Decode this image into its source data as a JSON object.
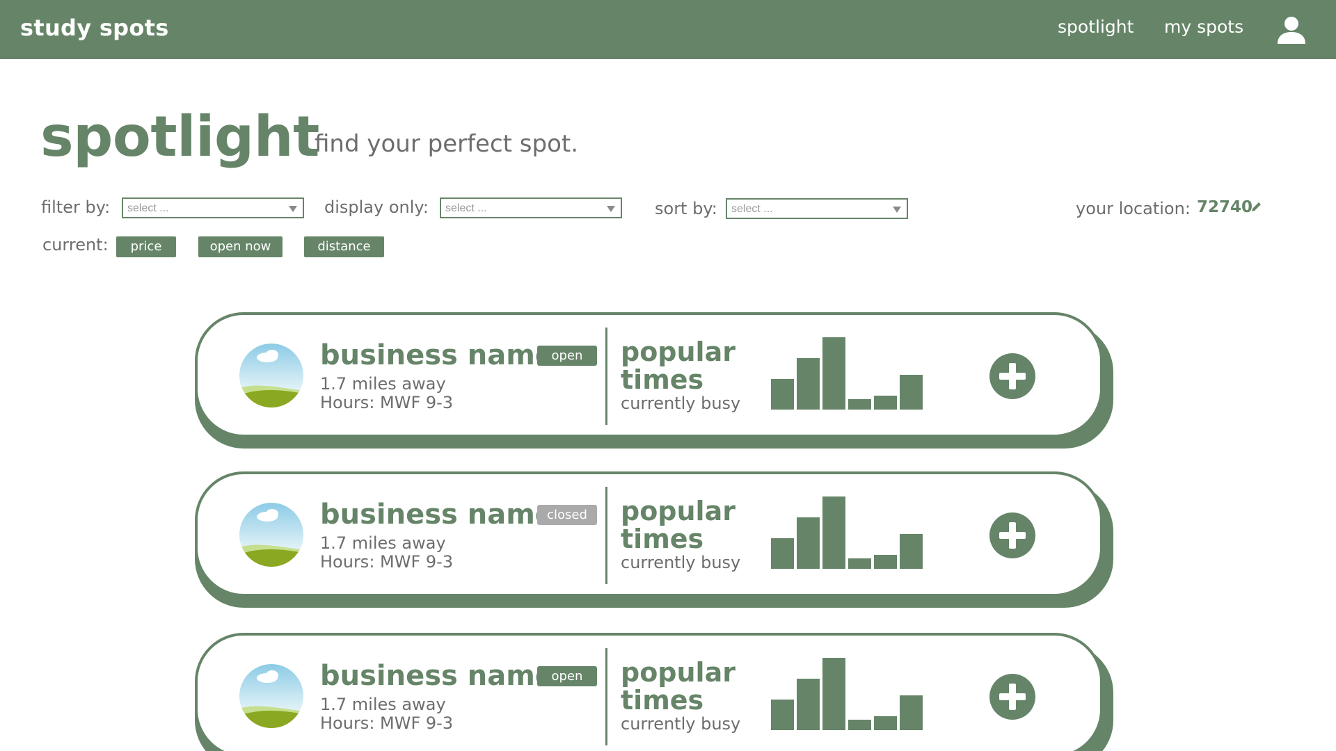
{
  "app": {
    "brand": "study spots",
    "nav": [
      {
        "label": "spotlight"
      },
      {
        "label": "my spots"
      }
    ],
    "user_icon": "user-icon"
  },
  "header": {
    "title": "spotlight",
    "subtitle": "find your perfect spot."
  },
  "controls": {
    "filter_label": "filter by:",
    "filter_placeholder": "select ...",
    "display_label": "display only:",
    "display_placeholder": "select ...",
    "sort_label": "sort by:",
    "sort_placeholder": "select ...",
    "location_label": "your location:",
    "location_value": "72740",
    "edit_icon": "pencil-icon"
  },
  "current": {
    "label": "current:",
    "chips": [
      "price",
      "open now",
      "distance"
    ]
  },
  "colors": {
    "accent": "#668568",
    "closed": "#aaaaaa",
    "text": "#6d6d6d"
  },
  "listings": [
    {
      "name": "business name",
      "status": "open",
      "distance": "1.7 miles away",
      "hours": "Hours: MWF 9-3",
      "popular_title_1": "popular",
      "popular_title_2": "times",
      "busyness": "currently busy",
      "popular_times": [
        0.42,
        0.71,
        1.0,
        0.14,
        0.19,
        0.48
      ]
    },
    {
      "name": "business name",
      "status": "closed",
      "distance": "1.7 miles away",
      "hours": "Hours: MWF 9-3",
      "popular_title_1": "popular",
      "popular_title_2": "times",
      "busyness": "currently busy",
      "popular_times": [
        0.42,
        0.71,
        1.0,
        0.14,
        0.19,
        0.48
      ]
    },
    {
      "name": "business name",
      "status": "open",
      "distance": "1.7 miles away",
      "hours": "Hours: MWF 9-3",
      "popular_title_1": "popular",
      "popular_title_2": "times",
      "busyness": "currently busy",
      "popular_times": [
        0.42,
        0.71,
        1.0,
        0.14,
        0.19,
        0.48
      ]
    }
  ]
}
